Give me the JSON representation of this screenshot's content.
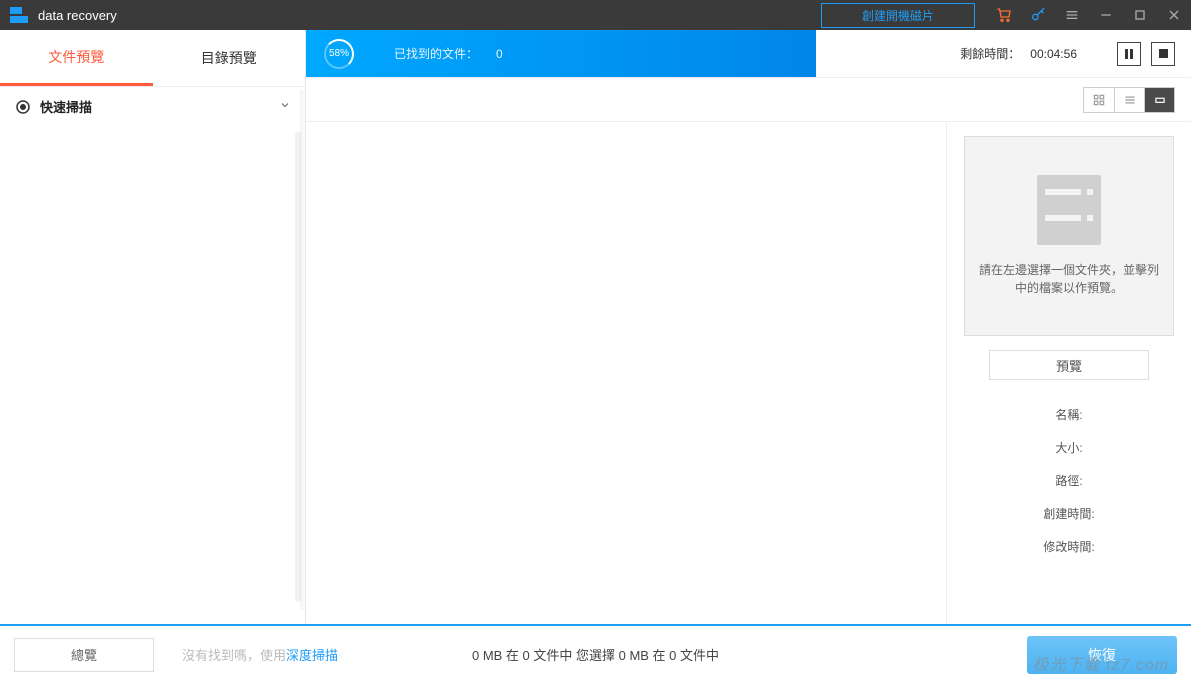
{
  "titlebar": {
    "app_name": "data recovery",
    "create_boot_disk": "創建開機磁片"
  },
  "sidebar": {
    "tabs": {
      "file_preview": "文件預覽",
      "dir_preview": "目錄預覽"
    },
    "quick_scan": "快速掃描"
  },
  "progress": {
    "percent": "58%",
    "found_label": "已找到的文件：",
    "found_count": "0",
    "remaining_label": "剩餘時間：",
    "remaining_time": "00:04:56"
  },
  "preview": {
    "hint": "請在左邊選擇一個文件夾，並擊列中的檔案以作預覽。",
    "preview_btn": "預覽",
    "meta": {
      "name": "名稱:",
      "size": "大小:",
      "path": "路徑:",
      "ctime": "創建時間:",
      "mtime": "修改時間:"
    }
  },
  "footer": {
    "overview": "總覽",
    "not_found_hint": "沒有找到嗎，使用 ",
    "deep_scan": "深度掃描",
    "stats": "0 MB 在 0 文件中  您選擇 0 MB 在 0 文件中",
    "recover": "恢復",
    "watermark": "极光下载 tz7.com"
  }
}
